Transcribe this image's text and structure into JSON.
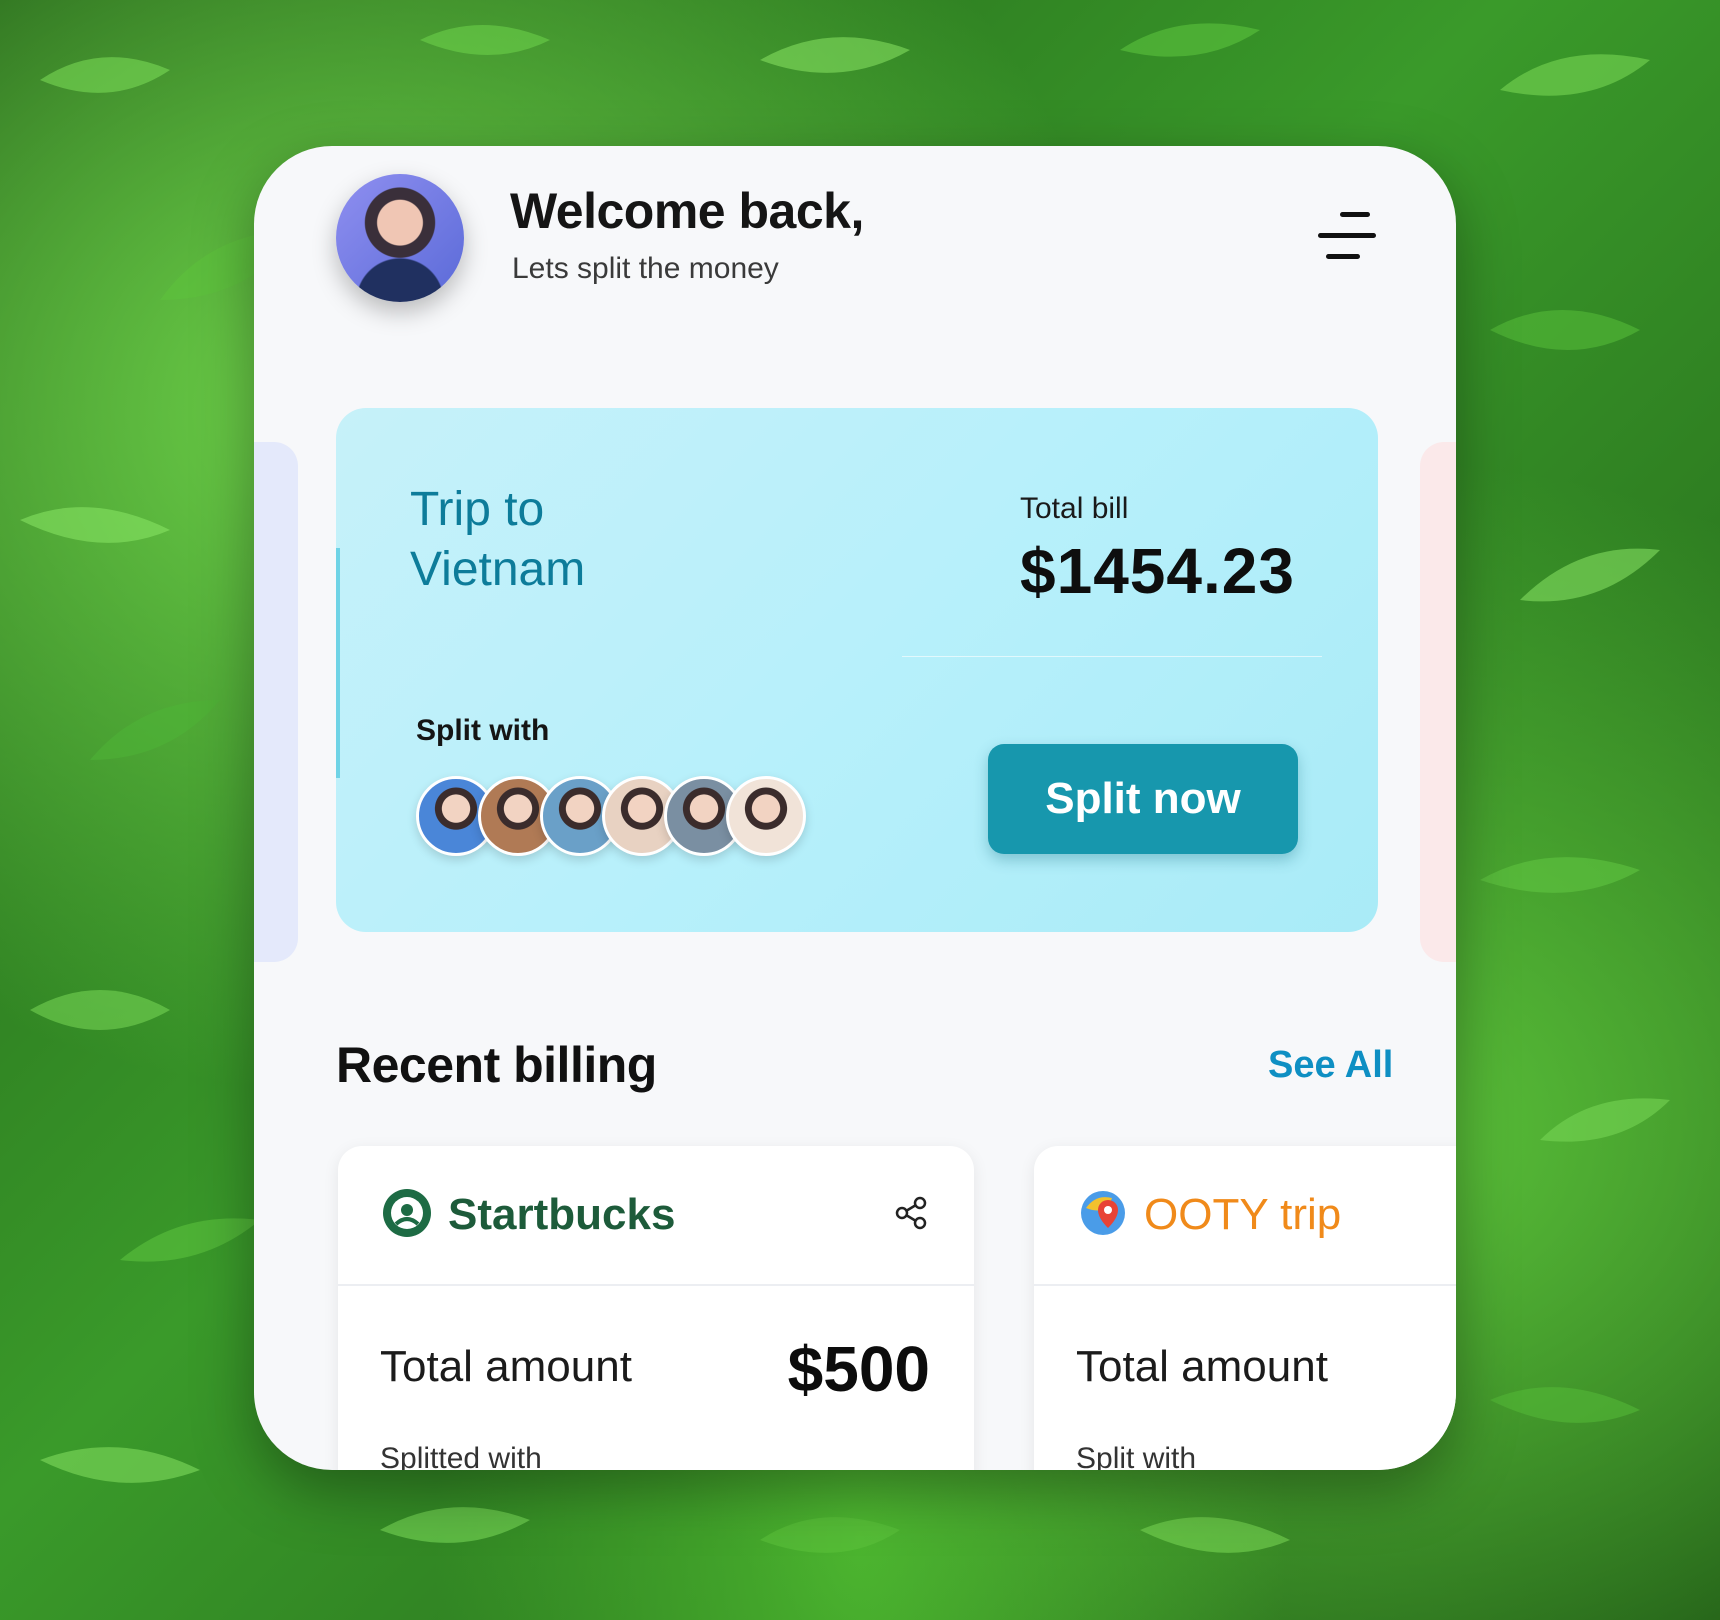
{
  "header": {
    "welcome": "Welcome back,",
    "subtitle": "Lets split the money",
    "avatar_icon": "user-avatar",
    "menu_icon": "menu-icon"
  },
  "trip": {
    "title": "Trip to Vietnam",
    "total_label": "Total bill",
    "total_value": "$1454.23",
    "split_label": "Split with",
    "split_button": "Split now",
    "participants": [
      {
        "color": "#4a86d8"
      },
      {
        "color": "#b07a55"
      },
      {
        "color": "#6aa0c8"
      },
      {
        "color": "#e8d2c2"
      },
      {
        "color": "#7a8fa2"
      },
      {
        "color": "#f1e3d8"
      }
    ]
  },
  "recent": {
    "title": "Recent billing",
    "see_all": "See All",
    "bills": [
      {
        "brand": "Startbucks",
        "brand_color": "#1d5b3a",
        "amount_label": "Total amount",
        "amount": "$500",
        "note": "Splitted with"
      },
      {
        "brand": "OOTY trip",
        "brand_color": "#f08a1a",
        "amount_label": "Total amount",
        "note": "Split with"
      }
    ]
  },
  "colors": {
    "accent": "#1797ad",
    "link": "#0e8fc3",
    "trip_title": "#0d7c9a"
  }
}
